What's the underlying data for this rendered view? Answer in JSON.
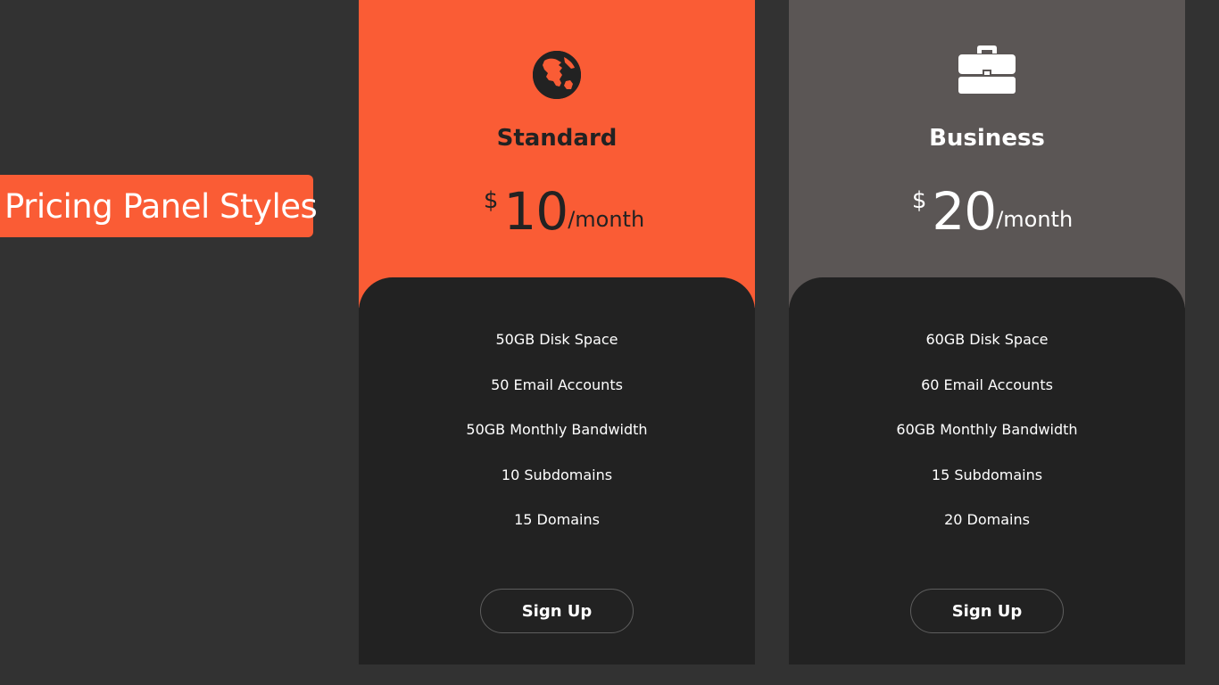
{
  "title": "Pricing Panel Styles",
  "colors": {
    "background": "#323232",
    "accent": "#fa5c35",
    "business_head": "#5b5655",
    "card_body": "#222222"
  },
  "plans": [
    {
      "icon": "globe-icon",
      "name": "Standard",
      "currency": "$",
      "price": "10",
      "period": "/month",
      "features": [
        "50GB Disk Space",
        "50 Email Accounts",
        "50GB Monthly Bandwidth",
        "10 Subdomains",
        "15 Domains"
      ],
      "cta": "Sign Up"
    },
    {
      "icon": "briefcase-icon",
      "name": "Business",
      "currency": "$",
      "price": "20",
      "period": "/month",
      "features": [
        "60GB Disk Space",
        "60 Email Accounts",
        "60GB Monthly Bandwidth",
        "15 Subdomains",
        "20 Domains"
      ],
      "cta": "Sign Up"
    }
  ]
}
